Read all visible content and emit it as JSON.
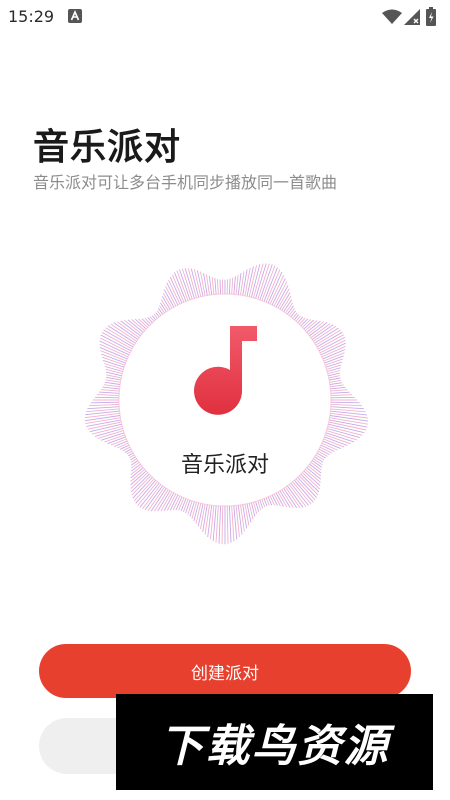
{
  "status_bar": {
    "time": "15:29",
    "icons": [
      "a-notification-icon",
      "wifi-icon",
      "signal-icon",
      "battery-icon"
    ]
  },
  "header": {
    "title": "音乐派对",
    "subtitle": "音乐派对可让多台手机同步播放同一首歌曲"
  },
  "visual": {
    "icon": "music-note-icon",
    "label": "音乐派对",
    "colors": {
      "note_top": "#f25a6a",
      "note_bottom": "#e0303f",
      "ring_pink": "#f3a3c2",
      "ring_purple": "#b795e8"
    }
  },
  "buttons": {
    "create_label": "创建派对",
    "create_color": "#e8402f",
    "join_color": "#efefef"
  },
  "watermark": {
    "text": "下载鸟资源"
  }
}
